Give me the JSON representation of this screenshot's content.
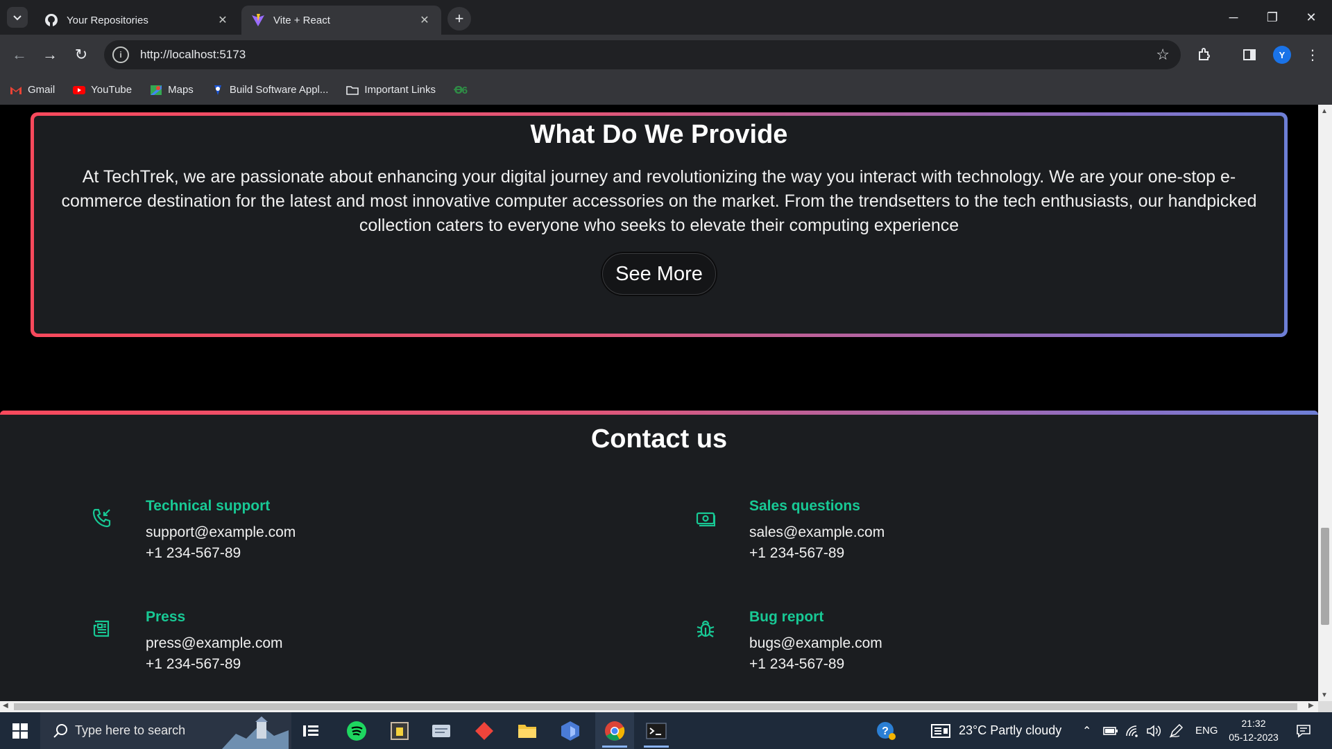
{
  "browser": {
    "tabs": [
      {
        "title": "Your Repositories",
        "active": false
      },
      {
        "title": "Vite + React",
        "active": true
      }
    ],
    "url": "http://localhost:5173",
    "avatar_letter": "Y",
    "bookmarks": [
      {
        "label": "Gmail",
        "icon": "gmail-icon"
      },
      {
        "label": "YouTube",
        "icon": "youtube-icon"
      },
      {
        "label": "Maps",
        "icon": "maps-icon"
      },
      {
        "label": "Build Software Appl...",
        "icon": "build-icon"
      },
      {
        "label": "Important Links",
        "icon": "folder-icon"
      },
      {
        "label": "",
        "icon": "geeksforgeeks-icon"
      }
    ]
  },
  "provide": {
    "title": "What Do We Provide",
    "text": "At TechTrek, we are passionate about enhancing your digital journey and revolutionizing the way you interact with technology. We are your one-stop e-commerce destination for the latest and most innovative computer accessories on the market. From the trendsetters to the tech enthusiasts, our handpicked collection caters to everyone who seeks to elevate their computing experience",
    "button": "See More"
  },
  "contact": {
    "title": "Contact us",
    "items": [
      {
        "label": "Technical support",
        "email": "support@example.com",
        "phone": "+1 234-567-89",
        "icon": "phone-incoming-icon"
      },
      {
        "label": "Sales questions",
        "email": "sales@example.com",
        "phone": "+1 234-567-89",
        "icon": "cash-icon"
      },
      {
        "label": "Press",
        "email": "press@example.com",
        "phone": "+1 234-567-89",
        "icon": "newspaper-icon"
      },
      {
        "label": "Bug report",
        "email": "bugs@example.com",
        "phone": "+1 234-567-89",
        "icon": "bug-icon"
      }
    ]
  },
  "taskbar": {
    "search_placeholder": "Type here to search",
    "weather": "23°C  Partly cloudy",
    "language": "ENG",
    "time": "21:32",
    "date": "05-12-2023"
  },
  "colors": {
    "accent_green": "#18c995",
    "gradient_start": "#f8495c",
    "gradient_end": "#6d7fd6"
  }
}
